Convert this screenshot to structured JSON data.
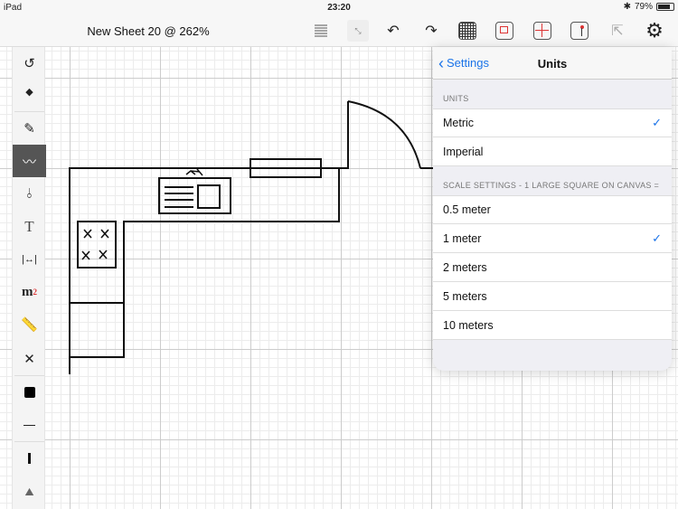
{
  "status": {
    "device": "iPad",
    "time": "23:20",
    "battery": "79%",
    "battery_level": 0.79
  },
  "toolbar": {
    "title": "New Sheet 20 @ 262%",
    "icons": [
      "list-icon",
      "fit-screen-icon",
      "undo-icon",
      "redo-icon",
      "grid-icon",
      "rectangle-select-icon",
      "crosshair-icon",
      "marker-icon",
      "share-icon",
      "gear-icon"
    ]
  },
  "tools": [
    "rotate-icon",
    "eraser-icon",
    "pencil-icon",
    "freehand-icon",
    "pen-line-icon",
    "text-icon",
    "dimension-icon",
    "area-icon",
    "ruler-icon",
    "delete-icon",
    "fill-color-icon",
    "line-thickness-icon",
    "line-width-icon",
    "image-icon"
  ],
  "tool_labels": {
    "text": "T",
    "area": "m",
    "area_sup": "2"
  },
  "panel": {
    "back": "Settings",
    "title": "Units",
    "section1": "UNITS",
    "units": [
      {
        "label": "Metric",
        "checked": true
      },
      {
        "label": "Imperial",
        "checked": false
      }
    ],
    "section2": "SCALE SETTINGS - 1 LARGE SQUARE ON CANVAS =",
    "scales": [
      {
        "label": "0.5 meter",
        "checked": false
      },
      {
        "label": "1 meter",
        "checked": true
      },
      {
        "label": "2 meters",
        "checked": false
      },
      {
        "label": "5 meters",
        "checked": false
      },
      {
        "label": "10 meters",
        "checked": false
      }
    ],
    "check": "✓"
  },
  "colors": {
    "accent": "#1a73e8",
    "active_tool": "#555555"
  }
}
